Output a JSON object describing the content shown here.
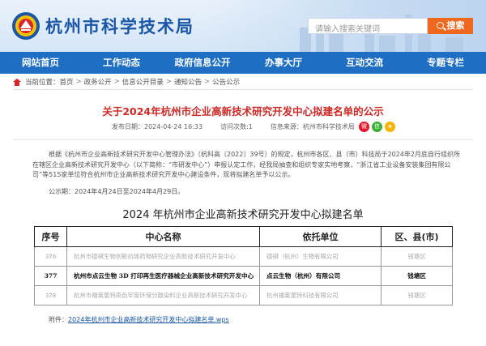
{
  "header": {
    "site_title": "杭州市科学技术局",
    "search_placeholder": "请输入搜索关键词",
    "search_button": "搜索"
  },
  "nav": {
    "items": [
      "网站首页",
      "工作动态",
      "政府信息公开",
      "办事大厅",
      "互动交流",
      "专题专栏"
    ]
  },
  "breadcrumb": {
    "label": "当前位置：",
    "items": [
      "首页",
      "政务公开",
      "信息公开目录",
      "通知公告",
      "公告公示"
    ],
    "sep": ">"
  },
  "article": {
    "title": "关于2024年杭州市企业高新技术研究开发中心拟建名单的公示",
    "meta": {
      "date": "发布日期：2024-04-24 16:33",
      "views": "访问次数:1",
      "source": "信息来源：杭州市科学技术局"
    },
    "paragraph": "根据《杭州市企业高新技术研究开发中心管理办法》（杭科高〔2022〕39号）的规定，杭州市各区、县（市）科技局于2024年2月底自行组织所在辖区企业高新技术研究开发中心（以下简称：“市研发中心”）申报认定工作，经我局抽查和组织专家实地考察，“浙江省工业设备安装集团有限公司”等515家单位符合杭州市企业高新技术研究开发中心建设条件，现将拟建名单予以公示。",
    "period": "公示期：2024年4月24日至2024年4月29日。",
    "list_title": "2024 年杭州市企业高新技术研究开发中心拟建名单",
    "attachment_label": "附件：",
    "attachment_link": "2024年杭州市企业高新技术研究开发中心拟建名单.wps"
  },
  "table": {
    "headers": [
      "序号",
      "中心名称",
      "依托单位",
      "区、县(市)"
    ],
    "rows": [
      {
        "no": "376",
        "name": "杭州市德祺生物创新抗体药物研究企业高新技术研究开发中心",
        "unit": "德祺（杭州）生物有限公司",
        "district": "钱塘区"
      },
      {
        "no": "377",
        "name": "杭州市点云生物 3D 打印再生医疗器械企业高新技术研究开发中心",
        "unit": "点云生物（杭州）有限公司",
        "district": "钱塘区"
      },
      {
        "no": "378",
        "name": "杭州市福莱蒽特高色牢度环保分散染料企业高新技术研究开发中心",
        "unit": "杭州福莱蒽特科技有限公司",
        "district": "钱塘区"
      }
    ]
  },
  "colors": {
    "brand_blue": "#1e6fc4",
    "title_red": "#cc2a26",
    "search_orange": "#f0681e"
  }
}
